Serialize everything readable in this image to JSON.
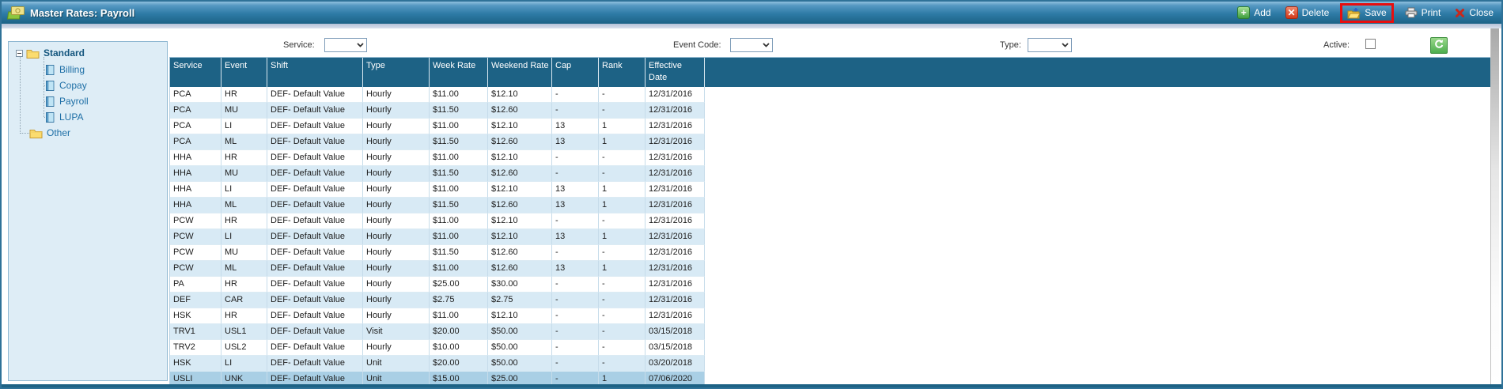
{
  "window": {
    "title": "Master Rates: Payroll"
  },
  "toolbar": {
    "add": "Add",
    "delete": "Delete",
    "save": "Save",
    "print": "Print",
    "close": "Close",
    "save_highlighted": true
  },
  "filters": {
    "service_label": "Service:",
    "service_value": "",
    "event_code_label": "Event Code:",
    "event_code_value": "",
    "type_label": "Type:",
    "type_value": "",
    "active_label": "Active:",
    "active_checked": false
  },
  "sidebar": {
    "tree": [
      {
        "label": "Standard",
        "icon": "folder-icon",
        "bold": true,
        "expanded": true,
        "children": [
          {
            "label": "Billing",
            "icon": "notebook-icon"
          },
          {
            "label": "Copay",
            "icon": "notebook-icon"
          },
          {
            "label": "Payroll",
            "icon": "notebook-icon"
          },
          {
            "label": "LUPA",
            "icon": "notebook-icon"
          }
        ]
      },
      {
        "label": "Other",
        "icon": "folder-icon",
        "bold": false,
        "expanded": false,
        "children": []
      }
    ]
  },
  "table": {
    "columns": [
      "Service",
      "Event",
      "Shift",
      "Type",
      "Week Rate",
      "Weekend Rate",
      "Cap",
      "Rank",
      "Effective Date"
    ],
    "column_keys": [
      "service",
      "event",
      "shift",
      "type",
      "week_rate",
      "weekend_rate",
      "cap",
      "rank",
      "effective_date"
    ],
    "selected_row_index": 18,
    "rows": [
      [
        "PCA",
        "HR",
        "DEF- Default Value",
        "Hourly",
        "$11.00",
        "$12.10",
        "-",
        "-",
        "12/31/2016"
      ],
      [
        "PCA",
        "MU",
        "DEF- Default Value",
        "Hourly",
        "$11.50",
        "$12.60",
        "-",
        "-",
        "12/31/2016"
      ],
      [
        "PCA",
        "LI",
        "DEF- Default Value",
        "Hourly",
        "$11.00",
        "$12.10",
        "13",
        "1",
        "12/31/2016"
      ],
      [
        "PCA",
        "ML",
        "DEF- Default Value",
        "Hourly",
        "$11.50",
        "$12.60",
        "13",
        "1",
        "12/31/2016"
      ],
      [
        "HHA",
        "HR",
        "DEF- Default Value",
        "Hourly",
        "$11.00",
        "$12.10",
        "-",
        "-",
        "12/31/2016"
      ],
      [
        "HHA",
        "MU",
        "DEF- Default Value",
        "Hourly",
        "$11.50",
        "$12.60",
        "-",
        "-",
        "12/31/2016"
      ],
      [
        "HHA",
        "LI",
        "DEF- Default Value",
        "Hourly",
        "$11.00",
        "$12.10",
        "13",
        "1",
        "12/31/2016"
      ],
      [
        "HHA",
        "ML",
        "DEF- Default Value",
        "Hourly",
        "$11.50",
        "$12.60",
        "13",
        "1",
        "12/31/2016"
      ],
      [
        "PCW",
        "HR",
        "DEF- Default Value",
        "Hourly",
        "$11.00",
        "$12.10",
        "-",
        "-",
        "12/31/2016"
      ],
      [
        "PCW",
        "LI",
        "DEF- Default Value",
        "Hourly",
        "$11.00",
        "$12.10",
        "13",
        "1",
        "12/31/2016"
      ],
      [
        "PCW",
        "MU",
        "DEF- Default Value",
        "Hourly",
        "$11.50",
        "$12.60",
        "-",
        "-",
        "12/31/2016"
      ],
      [
        "PCW",
        "ML",
        "DEF- Default Value",
        "Hourly",
        "$11.00",
        "$12.60",
        "13",
        "1",
        "12/31/2016"
      ],
      [
        "PA",
        "HR",
        "DEF- Default Value",
        "Hourly",
        "$25.00",
        "$30.00",
        "-",
        "-",
        "12/31/2016"
      ],
      [
        "DEF",
        "CAR",
        "DEF- Default Value",
        "Hourly",
        "$2.75",
        "$2.75",
        "-",
        "-",
        "12/31/2016"
      ],
      [
        "HSK",
        "HR",
        "DEF- Default Value",
        "Hourly",
        "$11.00",
        "$12.10",
        "-",
        "-",
        "12/31/2016"
      ],
      [
        "TRV1",
        "USL1",
        "DEF- Default Value",
        "Visit",
        "$20.00",
        "$50.00",
        "-",
        "-",
        "03/15/2018"
      ],
      [
        "TRV2",
        "USL2",
        "DEF- Default Value",
        "Hourly",
        "$10.00",
        "$50.00",
        "-",
        "-",
        "03/15/2018"
      ],
      [
        "HSK",
        "LI",
        "DEF- Default Value",
        "Unit",
        "$20.00",
        "$50.00",
        "-",
        "-",
        "03/20/2018"
      ],
      [
        "USLI",
        "UNK",
        "DEF- Default Value",
        "Unit",
        "$15.00",
        "$25.00",
        "-",
        "1",
        "07/06/2020"
      ]
    ]
  },
  "colors": {
    "titlebar_bottom": "#1C6286",
    "header_bg": "#1D6285",
    "row_alt_bg": "#D8EAF5",
    "row_selected_bg": "#A9CFE5",
    "sidebar_bg": "#DEEDF6",
    "highlight_red": "#E80E0E",
    "refresh_green": "#4DAE4E",
    "tree_text": "#1E6FA6"
  }
}
